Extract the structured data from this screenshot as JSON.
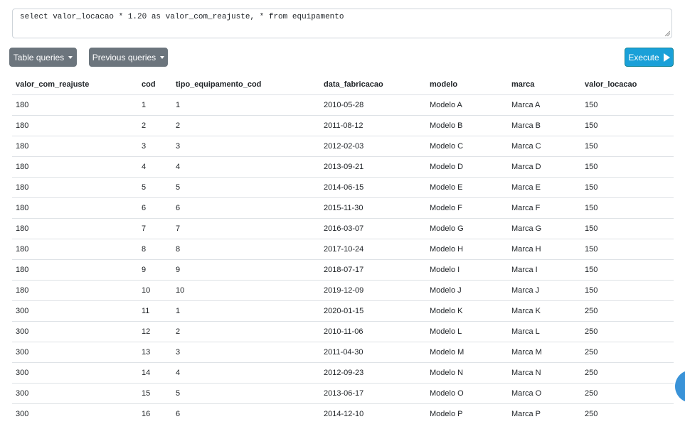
{
  "query": {
    "text": "select valor_locacao * 1.20 as valor_com_reajuste, * from equipamento"
  },
  "toolbar": {
    "table_queries_label": "Table queries",
    "previous_queries_label": "Previous queries",
    "execute_label": "Execute"
  },
  "results": {
    "columns": [
      "valor_com_reajuste",
      "cod",
      "tipo_equipamento_cod",
      "data_fabricacao",
      "modelo",
      "marca",
      "valor_locacao"
    ],
    "rows": [
      [
        "180",
        "1",
        "1",
        "2010-05-28",
        "Modelo A",
        "Marca A",
        "150"
      ],
      [
        "180",
        "2",
        "2",
        "2011-08-12",
        "Modelo B",
        "Marca B",
        "150"
      ],
      [
        "180",
        "3",
        "3",
        "2012-02-03",
        "Modelo C",
        "Marca C",
        "150"
      ],
      [
        "180",
        "4",
        "4",
        "2013-09-21",
        "Modelo D",
        "Marca D",
        "150"
      ],
      [
        "180",
        "5",
        "5",
        "2014-06-15",
        "Modelo E",
        "Marca E",
        "150"
      ],
      [
        "180",
        "6",
        "6",
        "2015-11-30",
        "Modelo F",
        "Marca F",
        "150"
      ],
      [
        "180",
        "7",
        "7",
        "2016-03-07",
        "Modelo G",
        "Marca G",
        "150"
      ],
      [
        "180",
        "8",
        "8",
        "2017-10-24",
        "Modelo H",
        "Marca H",
        "150"
      ],
      [
        "180",
        "9",
        "9",
        "2018-07-17",
        "Modelo I",
        "Marca I",
        "150"
      ],
      [
        "180",
        "10",
        "10",
        "2019-12-09",
        "Modelo J",
        "Marca J",
        "150"
      ],
      [
        "300",
        "11",
        "1",
        "2020-01-15",
        "Modelo K",
        "Marca K",
        "250"
      ],
      [
        "300",
        "12",
        "2",
        "2010-11-06",
        "Modelo L",
        "Marca L",
        "250"
      ],
      [
        "300",
        "13",
        "3",
        "2011-04-30",
        "Modelo M",
        "Marca M",
        "250"
      ],
      [
        "300",
        "14",
        "4",
        "2012-09-23",
        "Modelo N",
        "Marca N",
        "250"
      ],
      [
        "300",
        "15",
        "5",
        "2013-06-17",
        "Modelo O",
        "Marca O",
        "250"
      ],
      [
        "300",
        "16",
        "6",
        "2014-12-10",
        "Modelo P",
        "Marca P",
        "250"
      ]
    ]
  },
  "colors": {
    "secondary_button": "#6c757d",
    "execute_button": "#1aa0d8",
    "fab": "#3a93d8"
  },
  "icons": {
    "dropdown": "caret-down-icon",
    "execute": "play-icon"
  }
}
